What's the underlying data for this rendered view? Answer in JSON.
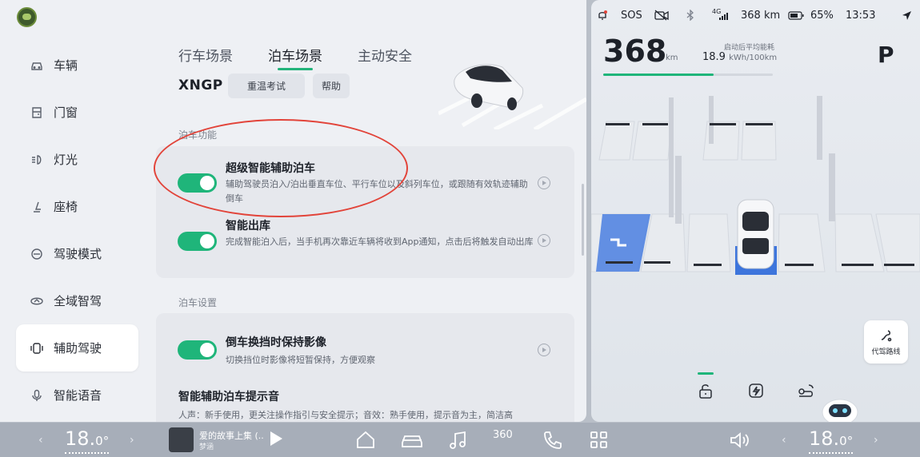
{
  "sidebar": {
    "items": [
      {
        "label": "车辆",
        "icon": "car-icon"
      },
      {
        "label": "门窗",
        "icon": "door-icon"
      },
      {
        "label": "灯光",
        "icon": "headlight-icon"
      },
      {
        "label": "座椅",
        "icon": "seat-icon"
      },
      {
        "label": "驾驶模式",
        "icon": "drive-mode-icon"
      },
      {
        "label": "全域智驾",
        "icon": "smart-drive-icon"
      },
      {
        "label": "辅助驾驶",
        "icon": "assist-drive-icon",
        "active": true
      },
      {
        "label": "智能语音",
        "icon": "microphone-icon"
      }
    ]
  },
  "tabs": [
    "行车场景",
    "泊车场景",
    "主动安全"
  ],
  "active_tab": "泊车场景",
  "xngp": {
    "label": "XNGP",
    "chip_review": "重温考试",
    "chip_help": "帮助"
  },
  "parking_functions": {
    "section_label": "泊车功能",
    "items": [
      {
        "title": "超级智能辅助泊车",
        "desc": "辅助驾驶员泊入/泊出垂直车位、平行车位以及斜列车位，或跟随有效轨迹辅助倒车",
        "enabled": true
      },
      {
        "title": "智能出库",
        "desc": "完成智能泊入后，当手机再次靠近车辆将收到App通知，点击后将触发自动出库",
        "enabled": true
      }
    ]
  },
  "parking_settings": {
    "section_label": "泊车设置",
    "items": [
      {
        "title": "倒车换挡时保持影像",
        "desc": "切换挡位时影像将短暂保持，方便观察",
        "enabled": true
      },
      {
        "title": "智能辅助泊车提示音",
        "desc": "人声：新手使用，更关注操作指引与安全提示；音效：熟手使用，提示音为主，简洁高"
      }
    ]
  },
  "status": {
    "sos": "SOS",
    "signal": "4G",
    "range": "368 km",
    "battery": "65%",
    "time": "13:53"
  },
  "vehicle": {
    "range_value": "368",
    "range_unit": "km",
    "eff_label": "启动后平均能耗",
    "eff_value": "18.9",
    "eff_unit": "kWh/100km",
    "range_fraction": 0.65,
    "gear": "P"
  },
  "route_button": {
    "label": "代驾路线"
  },
  "dock": {
    "left_temp_int": "18.",
    "left_temp_dec": "0",
    "left_temp_deg": "°",
    "right_temp_int": "18.",
    "right_temp_dec": "0",
    "right_temp_deg": "°",
    "song": "爱的故事上集 (..",
    "artist": "梦涵",
    "label_360": "360"
  },
  "colors": {
    "accent": "#1fb57a",
    "annotation": "#e2443a",
    "slot_highlight": "#4a7fe0"
  }
}
